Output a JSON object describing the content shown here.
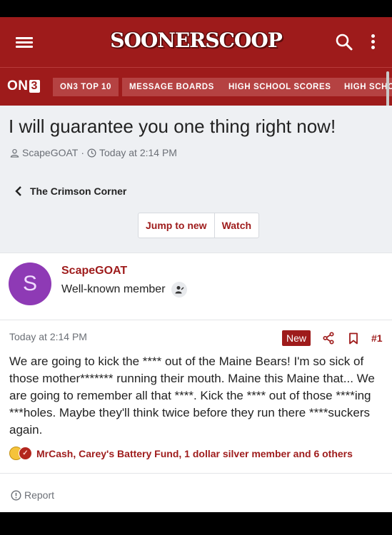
{
  "header": {
    "logo_text": "SOONERSCOOP",
    "menu_icon": "hamburger-menu-icon",
    "search_icon": "search-icon",
    "more_icon": "more-vertical-icon",
    "brand_color": "#9e1b1b"
  },
  "nav": {
    "brand_prefix": "ON",
    "brand_suffix": "3",
    "items": [
      {
        "label": "ON3 TOP 10"
      },
      {
        "label": "MESSAGE BOARDS"
      },
      {
        "label": "HIGH SCHOOL SCORES"
      },
      {
        "label": "HIGH SCHO"
      }
    ]
  },
  "thread": {
    "title": "I will guarantee you one thing right now!",
    "author": "ScapeGOAT",
    "separator": "·",
    "time": "Today at 2:14 PM",
    "forum_crumb": "The Crimson Corner",
    "buttons": {
      "jump_to_new": "Jump to new",
      "watch": "Watch"
    }
  },
  "user": {
    "avatar_letter": "S",
    "avatar_color": "#8e3ab5",
    "name": "ScapeGOAT",
    "title": "Well-known member"
  },
  "post": {
    "time": "Today at 2:14 PM",
    "badge": "New",
    "number": "#1",
    "body": "We are going to kick the **** out of the Maine Bears! I'm so sick of those mother******* running their mouth. Maine this Maine that... We are going to remember all that ****. Kick the **** out of those ****ing ***holes. Maybe they'll think twice before they run there ****suckers again.",
    "reactions": "MrCash, Carey's Battery Fund, 1 dollar silver member and 6 others"
  },
  "footer": {
    "report": "Report"
  }
}
